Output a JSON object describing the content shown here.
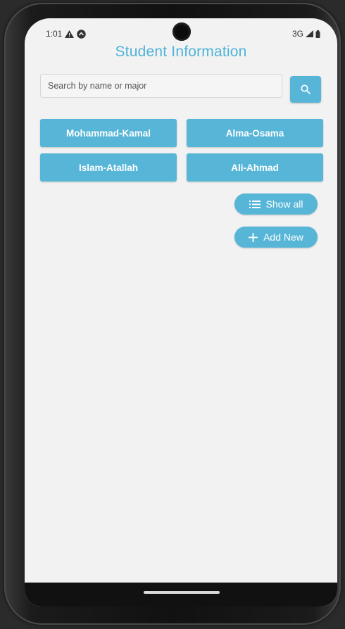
{
  "status_bar": {
    "time": "1:01",
    "network": "3G",
    "icons": [
      "warning-icon",
      "notification-icon",
      "signal-icon",
      "battery-icon"
    ]
  },
  "header": {
    "title": "Student Information"
  },
  "search": {
    "placeholder": "Search by name or major",
    "value": "",
    "button_icon": "search-icon"
  },
  "students": [
    {
      "label": "Mohammad-Kamal"
    },
    {
      "label": "Alma-Osama"
    },
    {
      "label": "Islam-Atallah"
    },
    {
      "label": "Ali-Ahmad"
    }
  ],
  "actions": {
    "show_all": {
      "label": "Show all",
      "icon": "list-icon"
    },
    "add_new": {
      "label": "Add New",
      "icon": "plus-icon"
    }
  },
  "colors": {
    "accent": "#57b6d8",
    "title": "#4fb3d9",
    "background": "#f2f2f2"
  }
}
